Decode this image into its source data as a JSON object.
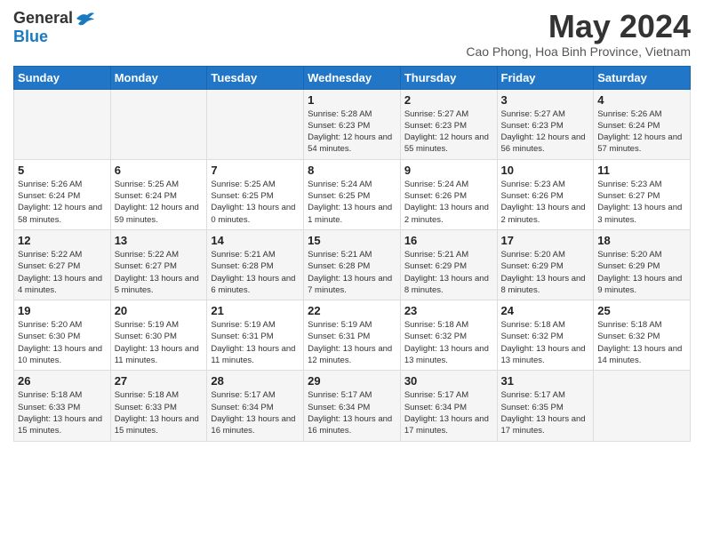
{
  "logo": {
    "general": "General",
    "blue": "Blue"
  },
  "title": "May 2024",
  "subtitle": "Cao Phong, Hoa Binh Province, Vietnam",
  "weekdays": [
    "Sunday",
    "Monday",
    "Tuesday",
    "Wednesday",
    "Thursday",
    "Friday",
    "Saturday"
  ],
  "weeks": [
    [
      {
        "day": "",
        "info": ""
      },
      {
        "day": "",
        "info": ""
      },
      {
        "day": "",
        "info": ""
      },
      {
        "day": "1",
        "info": "Sunrise: 5:28 AM\nSunset: 6:23 PM\nDaylight: 12 hours\nand 54 minutes."
      },
      {
        "day": "2",
        "info": "Sunrise: 5:27 AM\nSunset: 6:23 PM\nDaylight: 12 hours\nand 55 minutes."
      },
      {
        "day": "3",
        "info": "Sunrise: 5:27 AM\nSunset: 6:23 PM\nDaylight: 12 hours\nand 56 minutes."
      },
      {
        "day": "4",
        "info": "Sunrise: 5:26 AM\nSunset: 6:24 PM\nDaylight: 12 hours\nand 57 minutes."
      }
    ],
    [
      {
        "day": "5",
        "info": "Sunrise: 5:26 AM\nSunset: 6:24 PM\nDaylight: 12 hours\nand 58 minutes."
      },
      {
        "day": "6",
        "info": "Sunrise: 5:25 AM\nSunset: 6:24 PM\nDaylight: 12 hours\nand 59 minutes."
      },
      {
        "day": "7",
        "info": "Sunrise: 5:25 AM\nSunset: 6:25 PM\nDaylight: 13 hours\nand 0 minutes."
      },
      {
        "day": "8",
        "info": "Sunrise: 5:24 AM\nSunset: 6:25 PM\nDaylight: 13 hours\nand 1 minute."
      },
      {
        "day": "9",
        "info": "Sunrise: 5:24 AM\nSunset: 6:26 PM\nDaylight: 13 hours\nand 2 minutes."
      },
      {
        "day": "10",
        "info": "Sunrise: 5:23 AM\nSunset: 6:26 PM\nDaylight: 13 hours\nand 2 minutes."
      },
      {
        "day": "11",
        "info": "Sunrise: 5:23 AM\nSunset: 6:27 PM\nDaylight: 13 hours\nand 3 minutes."
      }
    ],
    [
      {
        "day": "12",
        "info": "Sunrise: 5:22 AM\nSunset: 6:27 PM\nDaylight: 13 hours\nand 4 minutes."
      },
      {
        "day": "13",
        "info": "Sunrise: 5:22 AM\nSunset: 6:27 PM\nDaylight: 13 hours\nand 5 minutes."
      },
      {
        "day": "14",
        "info": "Sunrise: 5:21 AM\nSunset: 6:28 PM\nDaylight: 13 hours\nand 6 minutes."
      },
      {
        "day": "15",
        "info": "Sunrise: 5:21 AM\nSunset: 6:28 PM\nDaylight: 13 hours\nand 7 minutes."
      },
      {
        "day": "16",
        "info": "Sunrise: 5:21 AM\nSunset: 6:29 PM\nDaylight: 13 hours\nand 8 minutes."
      },
      {
        "day": "17",
        "info": "Sunrise: 5:20 AM\nSunset: 6:29 PM\nDaylight: 13 hours\nand 8 minutes."
      },
      {
        "day": "18",
        "info": "Sunrise: 5:20 AM\nSunset: 6:29 PM\nDaylight: 13 hours\nand 9 minutes."
      }
    ],
    [
      {
        "day": "19",
        "info": "Sunrise: 5:20 AM\nSunset: 6:30 PM\nDaylight: 13 hours\nand 10 minutes."
      },
      {
        "day": "20",
        "info": "Sunrise: 5:19 AM\nSunset: 6:30 PM\nDaylight: 13 hours\nand 11 minutes."
      },
      {
        "day": "21",
        "info": "Sunrise: 5:19 AM\nSunset: 6:31 PM\nDaylight: 13 hours\nand 11 minutes."
      },
      {
        "day": "22",
        "info": "Sunrise: 5:19 AM\nSunset: 6:31 PM\nDaylight: 13 hours\nand 12 minutes."
      },
      {
        "day": "23",
        "info": "Sunrise: 5:18 AM\nSunset: 6:32 PM\nDaylight: 13 hours\nand 13 minutes."
      },
      {
        "day": "24",
        "info": "Sunrise: 5:18 AM\nSunset: 6:32 PM\nDaylight: 13 hours\nand 13 minutes."
      },
      {
        "day": "25",
        "info": "Sunrise: 5:18 AM\nSunset: 6:32 PM\nDaylight: 13 hours\nand 14 minutes."
      }
    ],
    [
      {
        "day": "26",
        "info": "Sunrise: 5:18 AM\nSunset: 6:33 PM\nDaylight: 13 hours\nand 15 minutes."
      },
      {
        "day": "27",
        "info": "Sunrise: 5:18 AM\nSunset: 6:33 PM\nDaylight: 13 hours\nand 15 minutes."
      },
      {
        "day": "28",
        "info": "Sunrise: 5:17 AM\nSunset: 6:34 PM\nDaylight: 13 hours\nand 16 minutes."
      },
      {
        "day": "29",
        "info": "Sunrise: 5:17 AM\nSunset: 6:34 PM\nDaylight: 13 hours\nand 16 minutes."
      },
      {
        "day": "30",
        "info": "Sunrise: 5:17 AM\nSunset: 6:34 PM\nDaylight: 13 hours\nand 17 minutes."
      },
      {
        "day": "31",
        "info": "Sunrise: 5:17 AM\nSunset: 6:35 PM\nDaylight: 13 hours\nand 17 minutes."
      },
      {
        "day": "",
        "info": ""
      }
    ]
  ]
}
